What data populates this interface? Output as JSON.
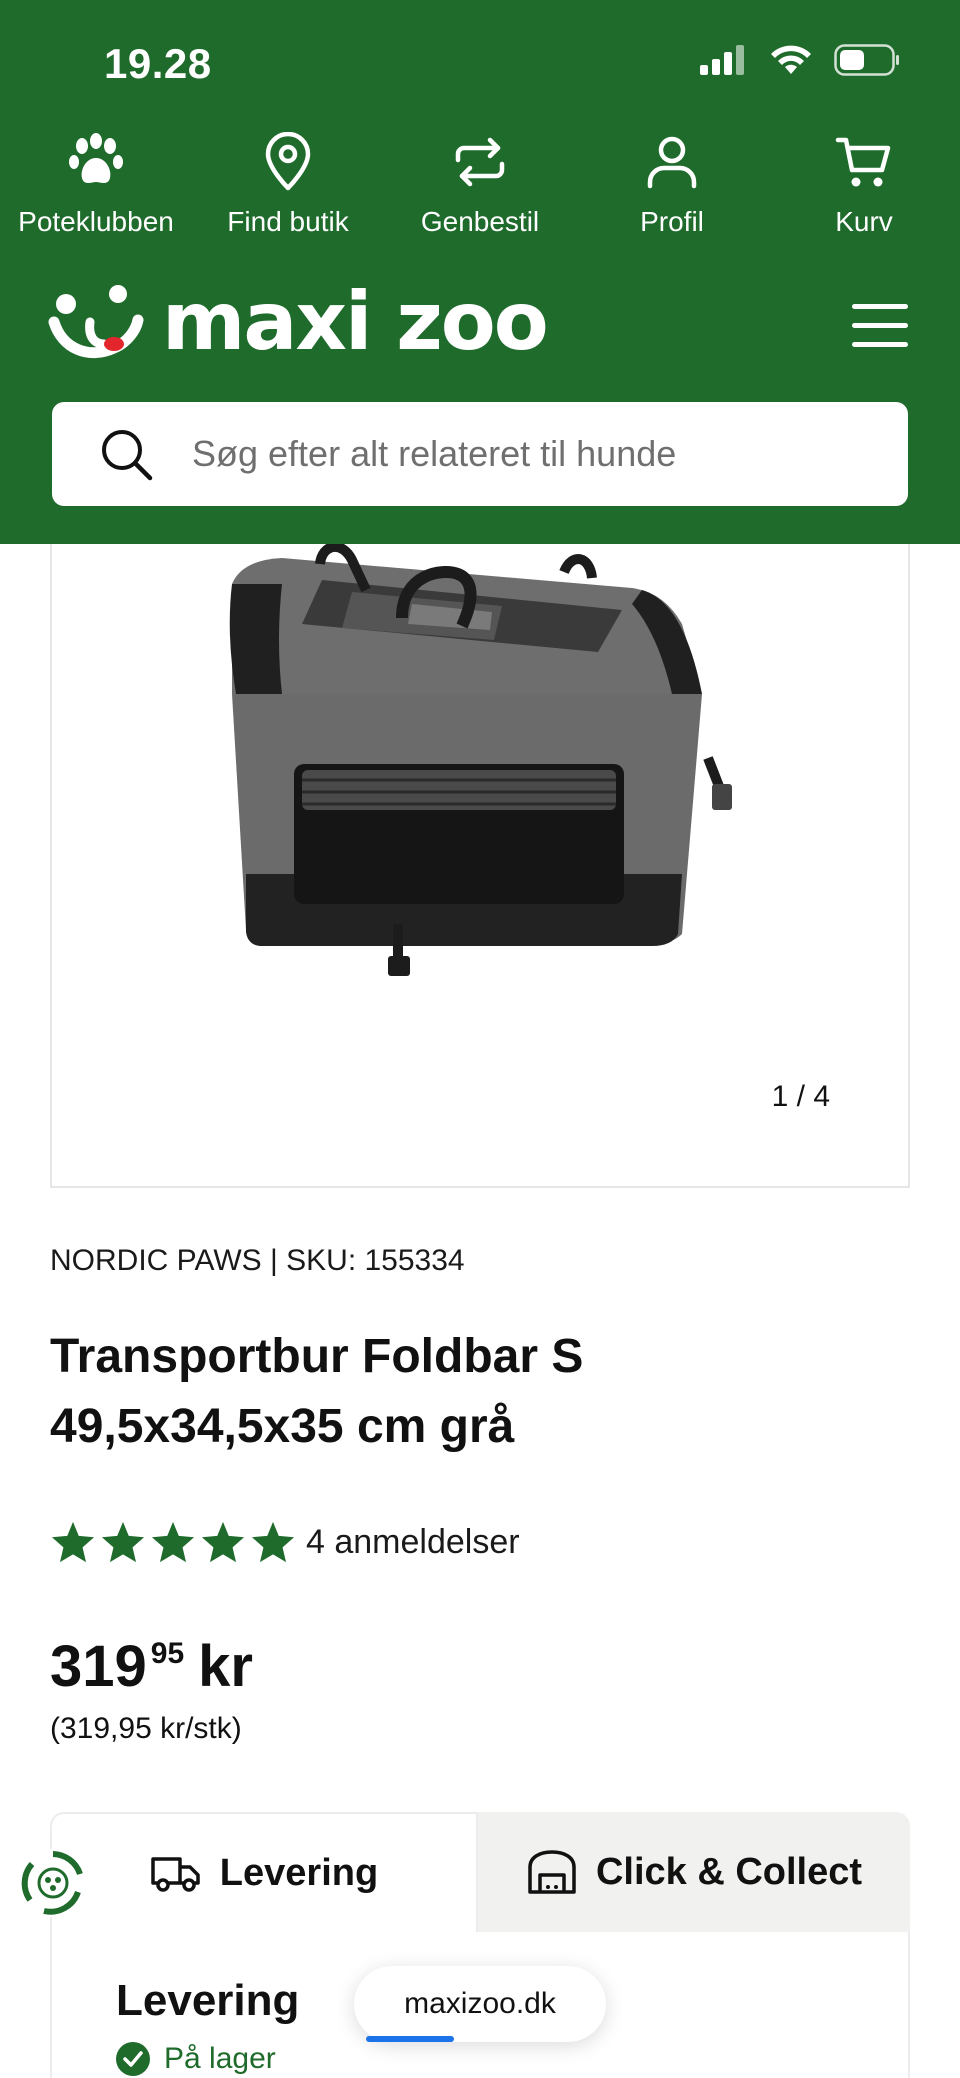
{
  "status_bar": {
    "time": "19.28"
  },
  "topnav": [
    {
      "id": "poteklubben",
      "label": "Poteklubben",
      "icon": "paw-icon"
    },
    {
      "id": "find-butik",
      "label": "Find butik",
      "icon": "map-pin-icon"
    },
    {
      "id": "genbestil",
      "label": "Genbestil",
      "icon": "repeat-icon"
    },
    {
      "id": "profil",
      "label": "Profil",
      "icon": "user-icon"
    },
    {
      "id": "kurv",
      "label": "Kurv",
      "icon": "cart-icon"
    }
  ],
  "brand": {
    "logo_text": "maxi zoo"
  },
  "search": {
    "placeholder": "Søg efter alt relateret til hunde"
  },
  "gallery": {
    "counter": "1 / 4"
  },
  "product": {
    "brand_sku": "NORDIC PAWS | SKU: 155334",
    "title": "Transportbur Foldbar S 49,5x34,5x35 cm grå",
    "rating": 5,
    "rating_max": 5,
    "review_count": "4 anmeldelser",
    "price_main": "319",
    "price_decimals": "95",
    "price_currency": "kr",
    "unit_price": "(319,95 kr/stk)"
  },
  "delivery": {
    "tabs": [
      {
        "label": "Levering",
        "icon": "truck-icon",
        "active": true
      },
      {
        "label": "Click & Collect",
        "icon": "store-icon",
        "active": false
      }
    ],
    "panel_title": "Levering",
    "stock_status": "På lager"
  },
  "browser": {
    "url": "maxizoo.dk",
    "load_progress": 0.35
  },
  "colors": {
    "brand_green": "#1f6b2c",
    "accent_red": "#e2262b",
    "link_blue": "#1a73e8"
  }
}
